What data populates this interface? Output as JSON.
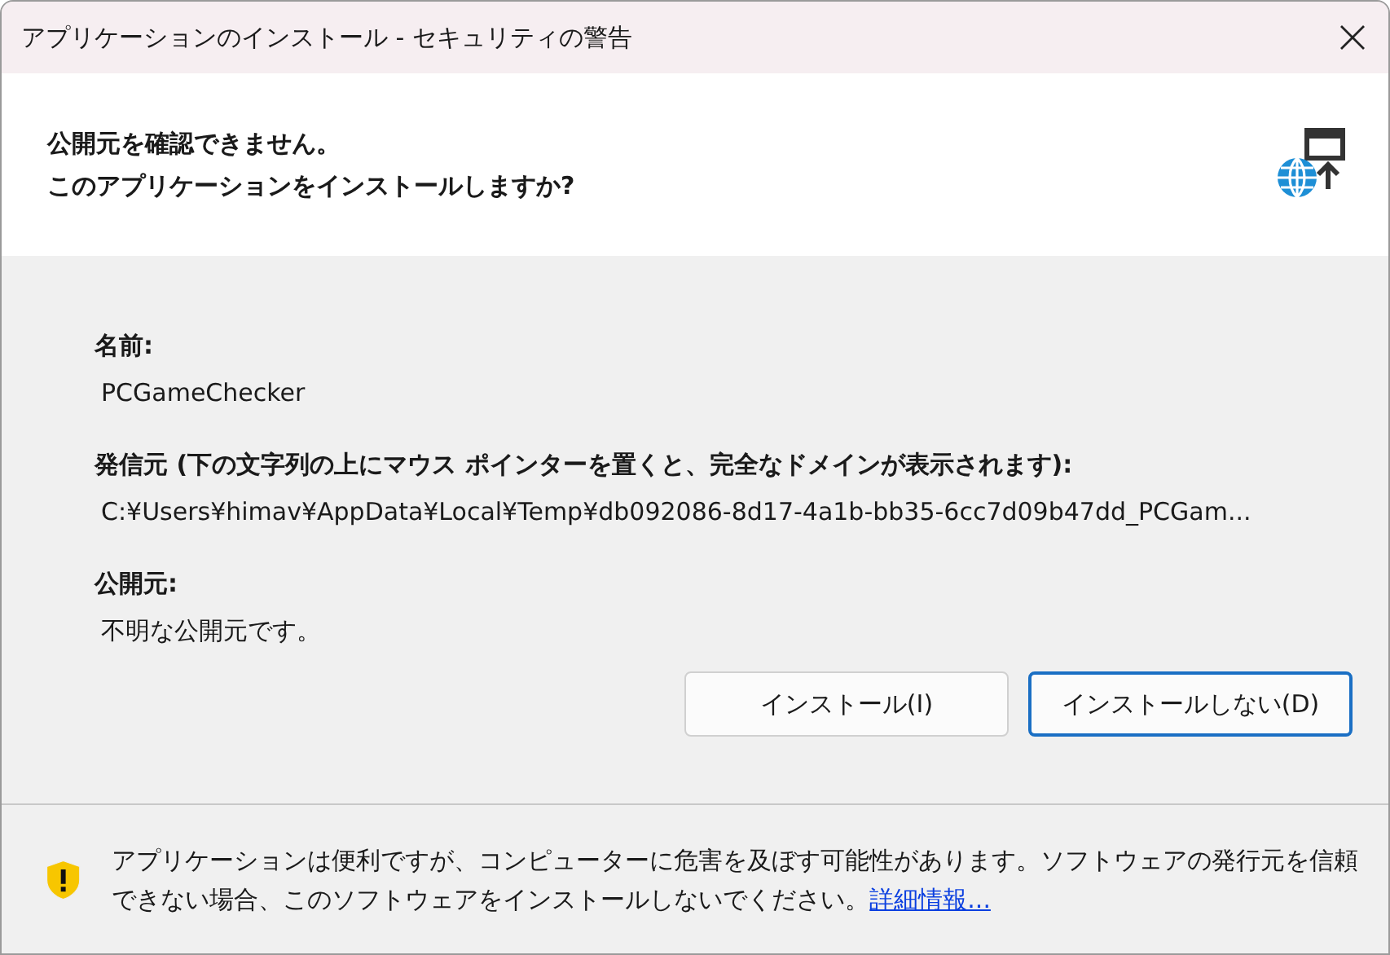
{
  "window": {
    "title": "アプリケーションのインストール - セキュリティの警告"
  },
  "header": {
    "lines": [
      "公開元を確認できません。",
      "このアプリケーションをインストールしますか?"
    ]
  },
  "fields": [
    {
      "label": "名前:",
      "value": "PCGameChecker"
    },
    {
      "label": "発信元 (下の文字列の上にマウス ポインターを置くと、完全なドメインが表示されます):",
      "value": "C:¥Users¥himav¥AppData¥Local¥Temp¥db092086-8d17-4a1b-bb35-6cc7d09b47dd_PCGam..."
    },
    {
      "label": "公開元:",
      "value": "不明な公開元です。"
    }
  ],
  "buttons": [
    {
      "label": "インストール(I)",
      "focused": false
    },
    {
      "label": "インストールしない(D)",
      "focused": true
    }
  ],
  "footer": {
    "message": "アプリケーションは便利ですが、コンピューターに危害を及ぼす可能性があります。ソフトウェアの発行元を信頼できない場合、このソフトウェアをインストールしないでください。",
    "link": "詳細情報..."
  }
}
